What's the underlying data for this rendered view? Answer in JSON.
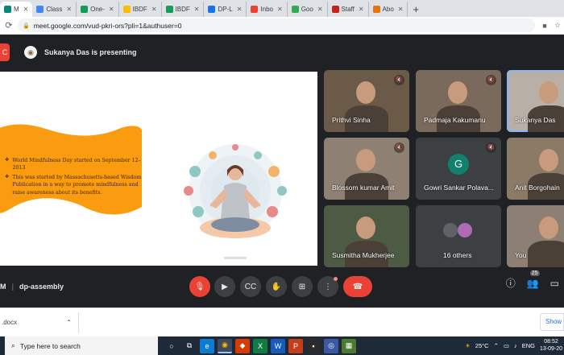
{
  "browser": {
    "tabs": [
      {
        "label": "M",
        "active": true,
        "fav_color": "#00897b"
      },
      {
        "label": "Class",
        "fav_color": "#4285f4"
      },
      {
        "label": "One-",
        "fav_color": "#0f9d58"
      },
      {
        "label": "IBDF",
        "fav_color": "#fbbc04"
      },
      {
        "label": "IBDF",
        "fav_color": "#0f9d58"
      },
      {
        "label": "DP-L",
        "fav_color": "#1a73e8"
      },
      {
        "label": "Inbo",
        "fav_color": "#ea4335"
      },
      {
        "label": "Goo",
        "fav_color": "#34a853"
      },
      {
        "label": "Staff",
        "fav_color": "#c5221f"
      },
      {
        "label": "Abo",
        "fav_color": "#e8710a"
      }
    ],
    "new_tab": "+",
    "url": "meet.google.com/vud-pkri-ors?pli=1&authuser=0"
  },
  "meet": {
    "presenting_text": "Sukanya Das is presenting",
    "meeting_time": "M",
    "meeting_code": "dp-assembly",
    "participant_count": "25",
    "slide": {
      "bullets": [
        "World Mindfulness Day started on September 12–2013",
        "This was started by Massachusetts-based Wisdom Publication in a way to promote mindfulness and raise awareness about its benefits."
      ],
      "bullet_icon": "❖"
    },
    "participants": [
      {
        "name": "Prithvi Sinha",
        "muted": true,
        "bg": "#6b5a48"
      },
      {
        "name": "Padmaja Kakumanu",
        "muted": true,
        "bg": "#7a6a5c"
      },
      {
        "name": "Sukanya Das",
        "muted": false,
        "bg": "#b8b0a6",
        "active": true
      },
      {
        "name": "Blossom kumar Amit",
        "muted": true,
        "bg": "#8e8072"
      },
      {
        "name": "Gowri Sankar Polava...",
        "muted": true,
        "bg": "#3c4043",
        "initial": "G"
      },
      {
        "name": "Anit Borgohain",
        "muted": false,
        "bg": "#8a7a66"
      },
      {
        "name": "Susmitha Mukherjee",
        "muted": false,
        "bg": "#4d5a44"
      },
      {
        "name": "16 others",
        "muted": false,
        "bg": "#3c4043"
      },
      {
        "name": "You",
        "muted": false,
        "bg": "#8d7f73"
      }
    ]
  },
  "downloads": {
    "file": ".docx",
    "show_all": "Show"
  },
  "taskbar": {
    "search_placeholder": "Type here to search",
    "weather": "25°C",
    "lang": "ENG",
    "time": "08:52",
    "date": "13-09-20"
  }
}
